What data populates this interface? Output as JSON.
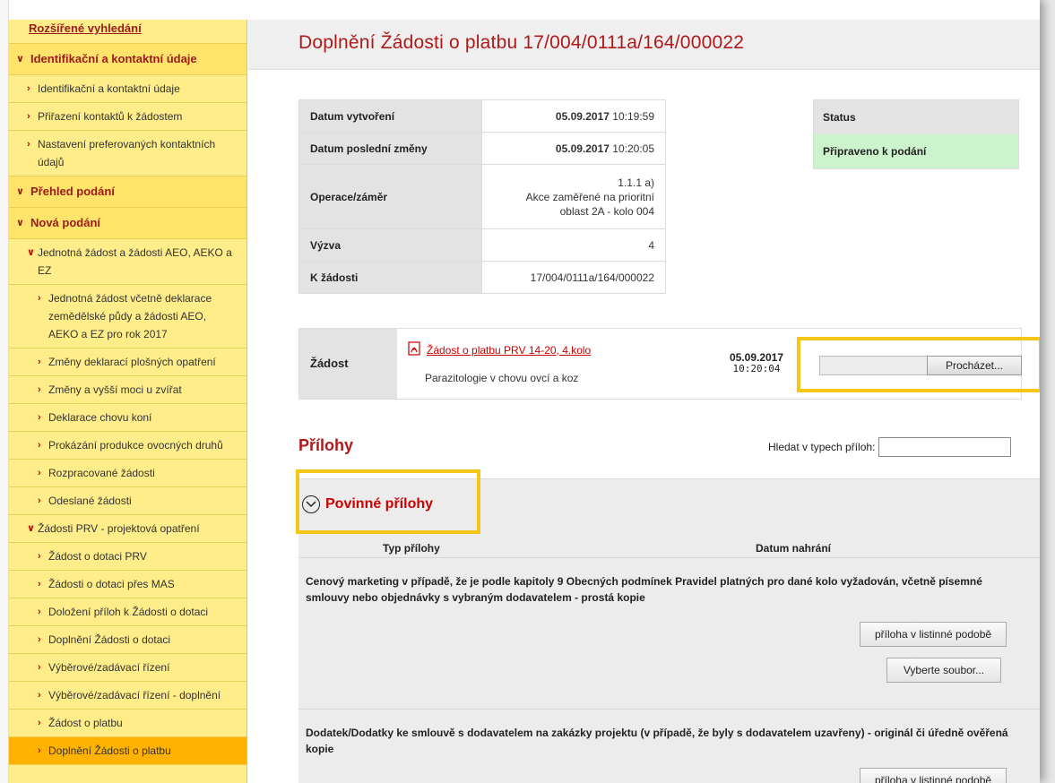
{
  "sidebar": {
    "items": [
      {
        "label": "Rozšířené vyhledání",
        "kind": "top"
      },
      {
        "label": "Identifikační a kontaktní údaje",
        "kind": "sect"
      },
      {
        "label": "Identifikační a kontaktní údaje",
        "kind": "lvl1"
      },
      {
        "label": "Přiřazení kontaktů k žádostem",
        "kind": "lvl1"
      },
      {
        "label": "Nastavení preferovaných kontaktních údajů",
        "kind": "lvl1"
      },
      {
        "label": "Přehled podání",
        "kind": "sect"
      },
      {
        "label": "Nová podání",
        "kind": "sect"
      },
      {
        "label": "Jednotná žádost a žádosti AEO, AEKO a EZ",
        "kind": "lvl1b"
      },
      {
        "label": "Jednotná žádost včetně deklarace zemědělské půdy a žádosti AEO, AEKO a EZ pro rok 2017",
        "kind": "lvl2"
      },
      {
        "label": "Změny deklarací plošných opatření",
        "kind": "lvl2"
      },
      {
        "label": "Změny a vyšší moci u zvířat",
        "kind": "lvl2"
      },
      {
        "label": "Deklarace chovu koní",
        "kind": "lvl2"
      },
      {
        "label": "Prokázání produkce ovocných druhů",
        "kind": "lvl2"
      },
      {
        "label": "Rozpracované žádosti",
        "kind": "lvl2"
      },
      {
        "label": "Odeslané žádosti",
        "kind": "lvl2"
      },
      {
        "label": "Žádosti PRV - projektová opatření",
        "kind": "lvl1b"
      },
      {
        "label": "Žádost o dotaci PRV",
        "kind": "lvl2"
      },
      {
        "label": "Žádosti o dotaci přes MAS",
        "kind": "lvl2"
      },
      {
        "label": "Doložení příloh k Žádosti o dotaci",
        "kind": "lvl2"
      },
      {
        "label": "Doplnění Žádosti o dotaci",
        "kind": "lvl2"
      },
      {
        "label": "Výběrové/zadávací řízení",
        "kind": "lvl2"
      },
      {
        "label": "Výběrové/zadávací řízení - doplnění",
        "kind": "lvl2"
      },
      {
        "label": "Žádost o platbu",
        "kind": "lvl2"
      },
      {
        "label": "Doplnění Žádosti o platbu",
        "kind": "lvl2",
        "active": true
      }
    ]
  },
  "main": {
    "title": "Doplnění Žádosti o platbu 17/004/0111a/164/000022",
    "info": {
      "created_label": "Datum vytvoření",
      "created_date": "05.09.2017",
      "created_time": " 10:19:59",
      "changed_label": "Datum poslední změny",
      "changed_date": "05.09.2017",
      "changed_time": " 10:20:05",
      "operation_label": "Operace/záměr",
      "operation_line1": "1.1.1 a)",
      "operation_line2": "Akce zaměřené na prioritní",
      "operation_line3": "oblast 2A - kolo 004",
      "call_label": "Výzva",
      "call_value": "4",
      "request_label": "K žádosti",
      "request_value": "17/004/0111a/164/000022"
    },
    "status": {
      "header": "Status",
      "value": "Připraveno k podání",
      "color": "#cdf3cd"
    },
    "zadost": {
      "label": "Žádost",
      "file_link": "Žádost o platbu PRV 14-20, 4.kolo",
      "file_icon": "pdf-icon",
      "description": "Parazitologie v chovu ovcí a koz",
      "date": "05.09.2017",
      "time": "10:20:04",
      "browse_label": "Procházet..."
    },
    "attachments": {
      "heading": "Přílohy",
      "search_label": "Hledat v typech příloh:",
      "search_value": "",
      "section_title": "Povinné přílohy",
      "col_type": "Typ přílohy",
      "col_date": "Datum nahrání",
      "rows": [
        {
          "text": "Cenový marketing v případě, že je podle kapitoly 9 Obecných podmínek Pravidel platných pro dané kolo vyžadován, včetně písemné smlouvy nebo objednávky s vybraným dodavatelem - prostá kopie",
          "paper_label": "příloha v listinné podobě",
          "select_label": "Vyberte soubor..."
        },
        {
          "text": "Dodatek/Dodatky ke smlouvě s dodavatelem na zakázky projektu (v případě, že byly s dodavatelem uzavřeny) - originál či úředně ověřená kopie",
          "paper_label": "příloha v listinné podobě"
        }
      ]
    },
    "colors": {
      "accent_red": "#b01919",
      "sidebar_bg": "#ffed8a",
      "highlight": "#f5c518"
    }
  }
}
